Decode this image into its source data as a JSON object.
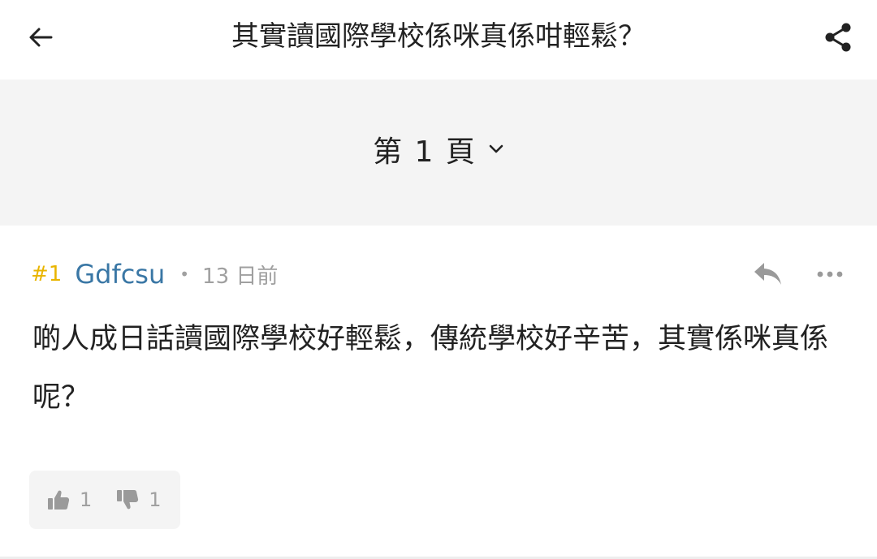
{
  "header": {
    "back_icon": "arrow-left-icon",
    "title": "其實讀國際學校係咪真係咁輕鬆？",
    "share_icon": "share-icon"
  },
  "pager": {
    "label": "第 1 頁",
    "dropdown_icon": "chevron-down-icon"
  },
  "post": {
    "floor": "#1",
    "username": "Gdfcsu",
    "separator": "•",
    "time": "13 日前",
    "reply_icon": "reply-icon",
    "more_icon": "more-horizontal-icon",
    "content": "啲人成日話讀國際學校好輕鬆，傳統學校好辛苦，其實係咪真係呢？",
    "likes": "1",
    "dislikes": "1"
  },
  "colors": {
    "floor": "#e9b500",
    "username": "#3a77a5",
    "muted": "#a0a0a0",
    "pager_bg": "#f4f4f4"
  }
}
